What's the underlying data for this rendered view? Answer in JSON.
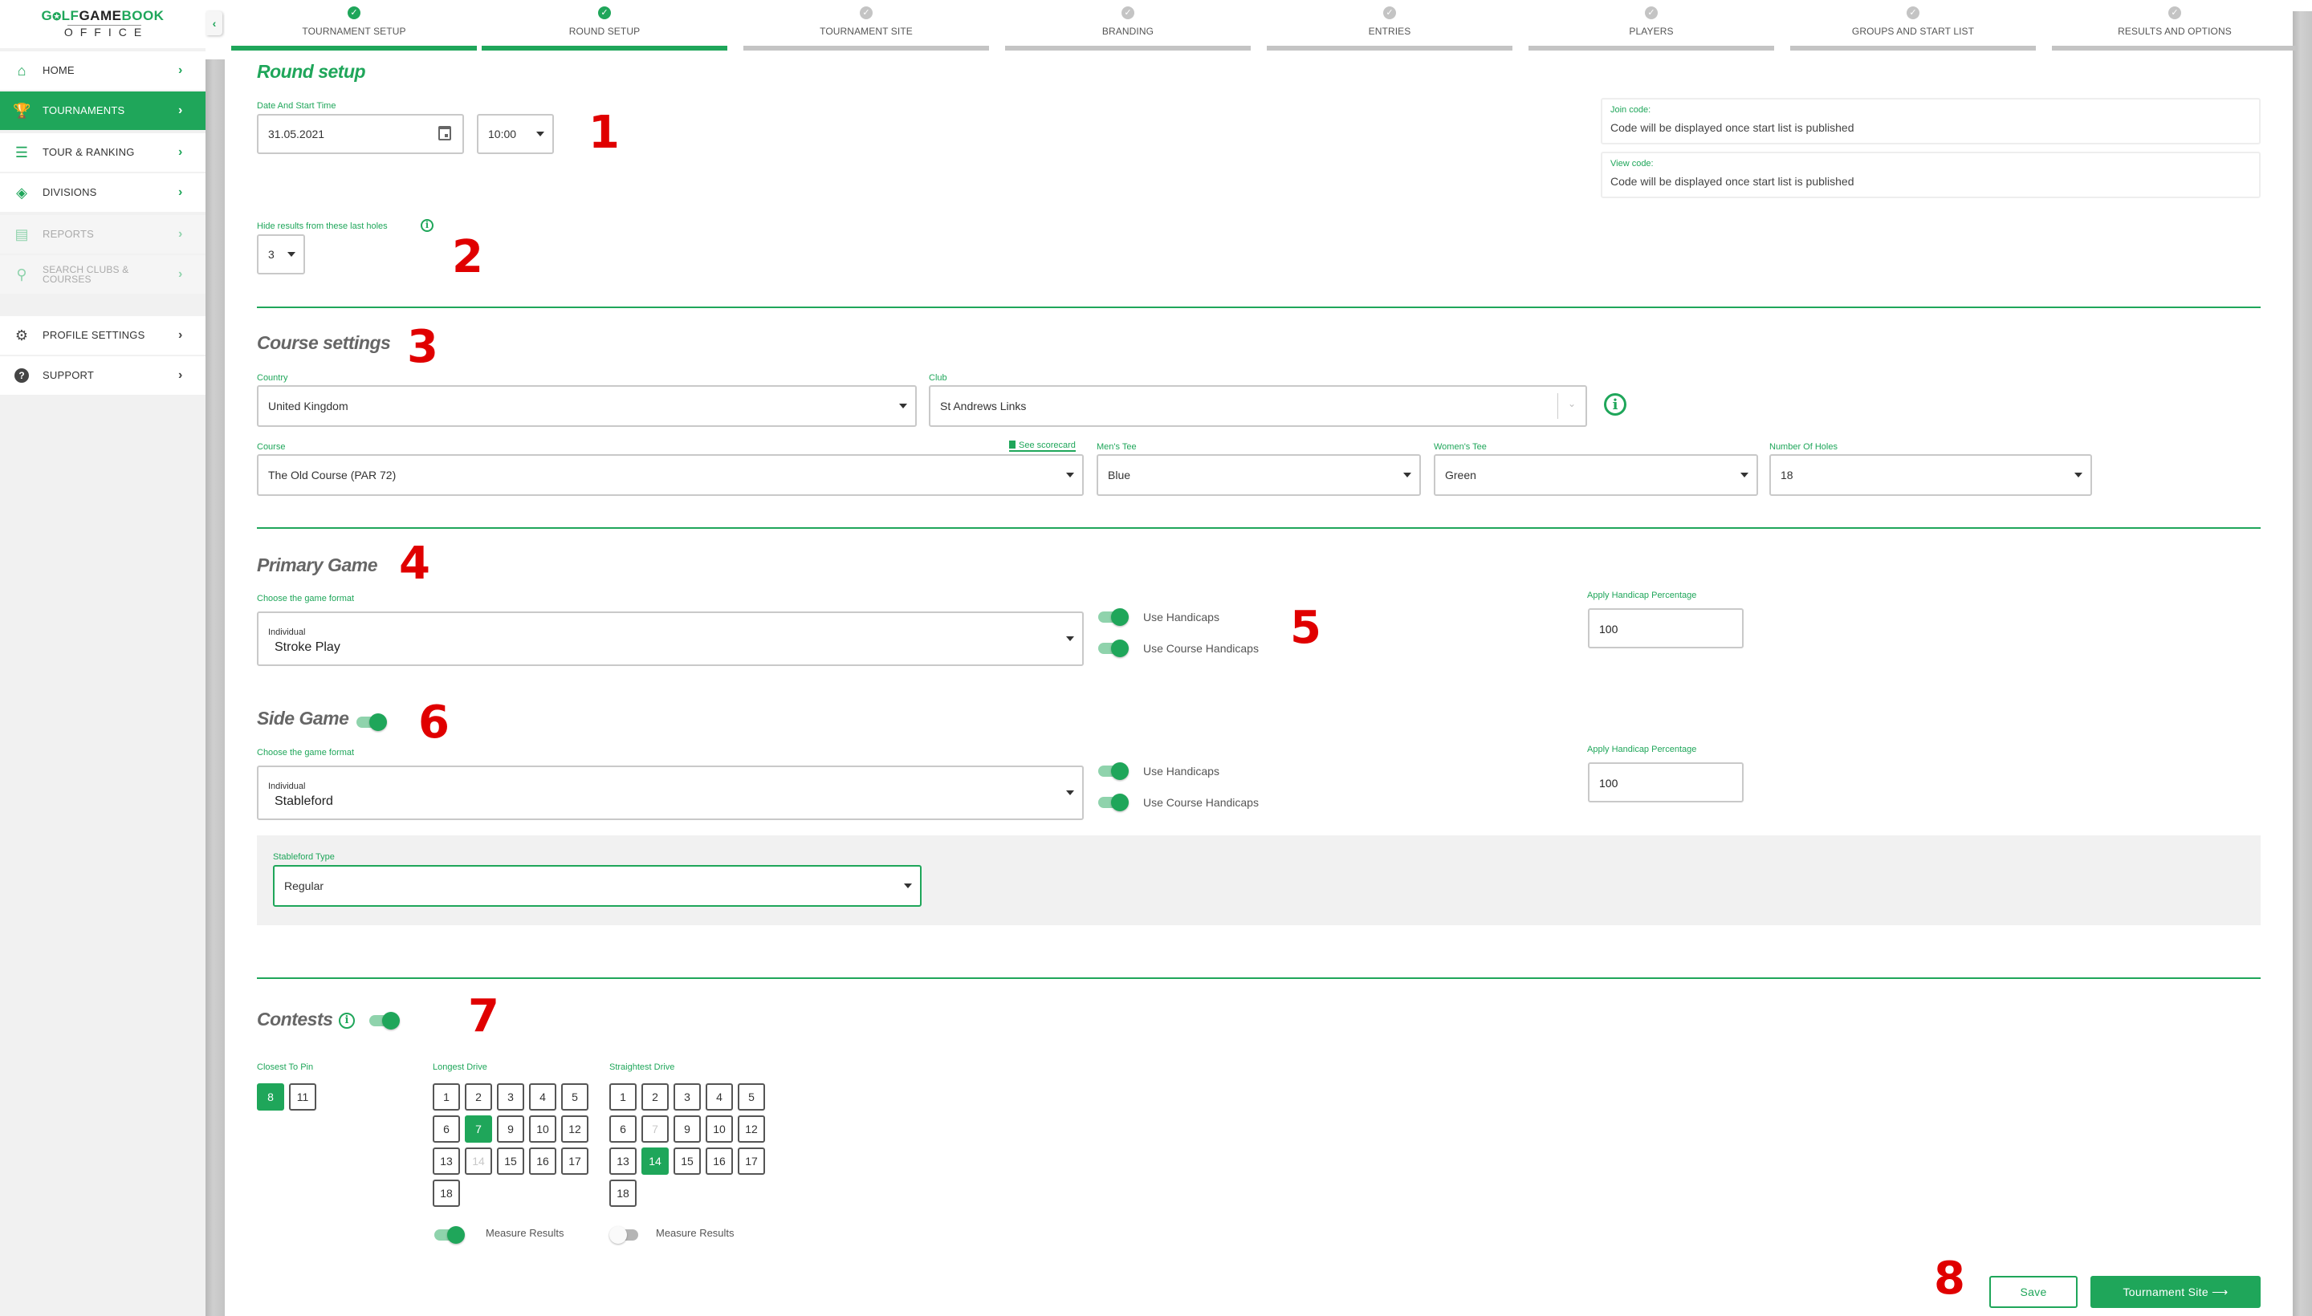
{
  "app": {
    "logo_top_green_1": "G",
    "logo_top_icon": "✪",
    "logo_top_green_2": "LF",
    "logo_top_dark": "GAME",
    "logo_top_green_3": "BOOK",
    "logo_bottom": "OFFICE"
  },
  "sidebar": {
    "items": [
      {
        "label": "HOME",
        "icon": "home-icon",
        "glyph": "⌂",
        "state": "normal"
      },
      {
        "label": "TOURNAMENTS",
        "icon": "trophy-icon",
        "glyph": "🏆",
        "state": "active"
      },
      {
        "label": "TOUR & RANKING",
        "icon": "ranked-list-icon",
        "glyph": "☰",
        "state": "normal"
      },
      {
        "label": "DIVISIONS",
        "icon": "layers-icon",
        "glyph": "◈",
        "state": "normal"
      },
      {
        "label": "REPORTS",
        "icon": "document-icon",
        "glyph": "▤",
        "state": "disabled"
      },
      {
        "label": "SEARCH CLUBS &",
        "label2": "COURSES",
        "icon": "search-icon",
        "glyph": "⚲",
        "state": "disabled"
      },
      {
        "label": "PROFILE SETTINGS",
        "icon": "gear-icon",
        "glyph": "⚙",
        "state": "dark"
      },
      {
        "label": "SUPPORT",
        "icon": "help-icon",
        "glyph": "?",
        "state": "dark"
      }
    ],
    "chevron": "›",
    "collapse_glyph": "‹"
  },
  "stepper": {
    "check_glyph": "✓",
    "steps": [
      {
        "label": "TOURNAMENT SETUP",
        "done": true
      },
      {
        "label": "ROUND SETUP",
        "done": true
      },
      {
        "label": "TOURNAMENT SITE",
        "done": false
      },
      {
        "label": "BRANDING",
        "done": false
      },
      {
        "label": "ENTRIES",
        "done": false
      },
      {
        "label": "PLAYERS",
        "done": false
      },
      {
        "label": "GROUPS AND START LIST",
        "done": false
      },
      {
        "label": "RESULTS AND OPTIONS",
        "done": false
      }
    ]
  },
  "round_setup": {
    "title": "Round setup",
    "date_label": "Date And Start Time",
    "date_value": "31.05.2021",
    "time_value": "10:00",
    "hide_label": "Hide results from these last holes",
    "hide_value": "3",
    "join_code_label": "Join code:",
    "join_code_value": "Code will be displayed once start list is published",
    "view_code_label": "View code:",
    "view_code_value": "Code will be displayed once start list is published"
  },
  "course_settings": {
    "title": "Course settings",
    "country_label": "Country",
    "country_value": "United Kingdom",
    "club_label": "Club",
    "club_value": "St Andrews Links",
    "course_label": "Course",
    "course_value": "The Old Course (PAR 72)",
    "scorecard_link": "See scorecard",
    "mens_tee_label": "Men's Tee",
    "mens_tee_value": "Blue",
    "womens_tee_label": "Women's Tee",
    "womens_tee_value": "Green",
    "holes_label": "Number Of Holes",
    "holes_value": "18"
  },
  "primary_game": {
    "title": "Primary Game",
    "format_label": "Choose the game format",
    "format_type": "Individual",
    "format_value": "Stroke Play",
    "use_handicaps_label": "Use Handicaps",
    "use_handicaps": true,
    "use_course_handicaps_label": "Use Course Handicaps",
    "use_course_handicaps": true,
    "handicap_pct_label": "Apply Handicap Percentage",
    "handicap_pct_value": "100"
  },
  "side_game": {
    "title": "Side Game",
    "enabled": true,
    "format_label": "Choose the game format",
    "format_type": "Individual",
    "format_value": "Stableford",
    "use_handicaps_label": "Use Handicaps",
    "use_handicaps": true,
    "use_course_handicaps_label": "Use Course Handicaps",
    "use_course_handicaps": true,
    "handicap_pct_label": "Apply Handicap Percentage",
    "handicap_pct_value": "100",
    "stableford_type_label": "Stableford Type",
    "stableford_type_value": "Regular"
  },
  "contests": {
    "title": "Contests",
    "enabled": true,
    "closest_to_pin": {
      "label": "Closest To Pin",
      "holes": [
        {
          "n": "8",
          "state": "sel"
        },
        {
          "n": "11",
          "state": "normal"
        }
      ]
    },
    "longest_drive": {
      "label": "Longest Drive",
      "holes": [
        {
          "n": "1",
          "state": "normal"
        },
        {
          "n": "2",
          "state": "normal"
        },
        {
          "n": "3",
          "state": "normal"
        },
        {
          "n": "4",
          "state": "normal"
        },
        {
          "n": "5",
          "state": "normal"
        },
        {
          "n": "6",
          "state": "normal"
        },
        {
          "n": "7",
          "state": "sel"
        },
        {
          "n": "9",
          "state": "normal"
        },
        {
          "n": "10",
          "state": "normal"
        },
        {
          "n": "12",
          "state": "normal"
        },
        {
          "n": "13",
          "state": "normal"
        },
        {
          "n": "14",
          "state": "dis"
        },
        {
          "n": "15",
          "state": "normal"
        },
        {
          "n": "16",
          "state": "normal"
        },
        {
          "n": "17",
          "state": "normal"
        },
        {
          "n": "18",
          "state": "normal"
        }
      ],
      "measure_label": "Measure Results",
      "measure": true
    },
    "straightest_drive": {
      "label": "Straightest Drive",
      "holes": [
        {
          "n": "1",
          "state": "normal"
        },
        {
          "n": "2",
          "state": "normal"
        },
        {
          "n": "3",
          "state": "normal"
        },
        {
          "n": "4",
          "state": "normal"
        },
        {
          "n": "5",
          "state": "normal"
        },
        {
          "n": "6",
          "state": "normal"
        },
        {
          "n": "7",
          "state": "dis"
        },
        {
          "n": "9",
          "state": "normal"
        },
        {
          "n": "10",
          "state": "normal"
        },
        {
          "n": "12",
          "state": "normal"
        },
        {
          "n": "13",
          "state": "normal"
        },
        {
          "n": "14",
          "state": "sel"
        },
        {
          "n": "15",
          "state": "normal"
        },
        {
          "n": "16",
          "state": "normal"
        },
        {
          "n": "17",
          "state": "normal"
        },
        {
          "n": "18",
          "state": "normal"
        }
      ],
      "measure_label": "Measure Results",
      "measure": false
    }
  },
  "footer": {
    "save_label": "Save",
    "next_label": "Tournament Site",
    "next_arrow": "⟶"
  },
  "annotations": [
    "1",
    "2",
    "3",
    "4",
    "5",
    "6",
    "7",
    "8"
  ],
  "colors": {
    "brand_green": "#1fa65a",
    "light_green": "#8fd3ac",
    "inactive_gray": "#c4c4c4",
    "annotation_red": "#e00000"
  }
}
